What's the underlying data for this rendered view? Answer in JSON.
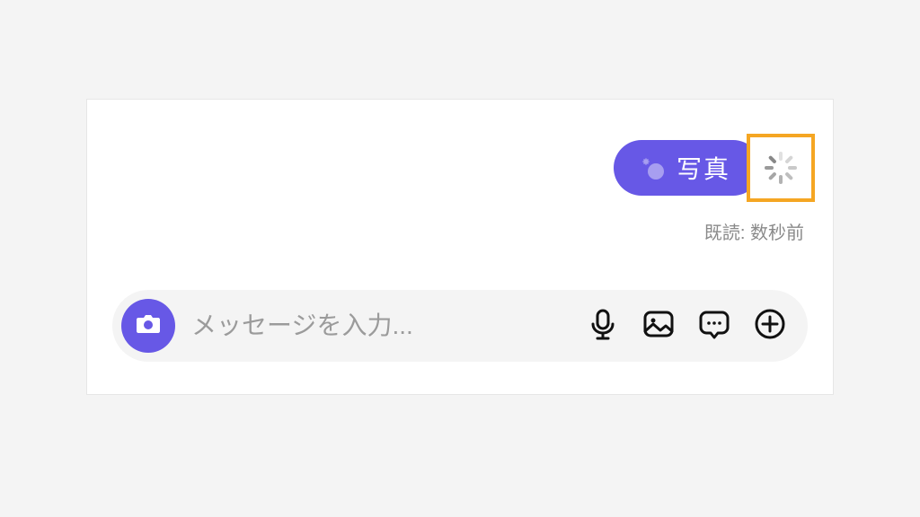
{
  "message": {
    "pill_label": "写真",
    "read_status": "既読: 数秒前"
  },
  "input": {
    "placeholder": "メッセージを入力..."
  },
  "colors": {
    "accent": "#6758e6",
    "highlight_border": "#f5a623"
  }
}
